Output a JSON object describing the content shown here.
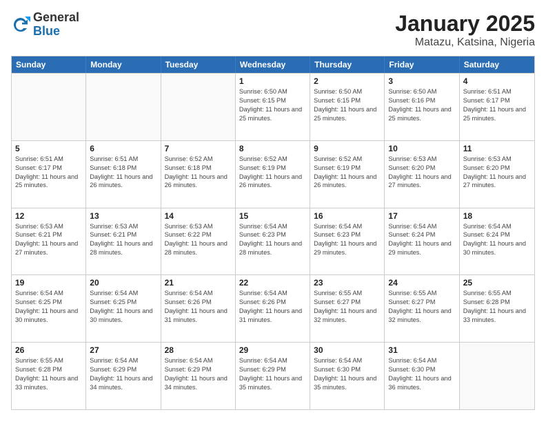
{
  "header": {
    "logo_general": "General",
    "logo_blue": "Blue",
    "title": "January 2025",
    "subtitle": "Matazu, Katsina, Nigeria"
  },
  "days_of_week": [
    "Sunday",
    "Monday",
    "Tuesday",
    "Wednesday",
    "Thursday",
    "Friday",
    "Saturday"
  ],
  "weeks": [
    [
      {
        "num": "",
        "info": ""
      },
      {
        "num": "",
        "info": ""
      },
      {
        "num": "",
        "info": ""
      },
      {
        "num": "1",
        "info": "Sunrise: 6:50 AM\nSunset: 6:15 PM\nDaylight: 11 hours and 25 minutes."
      },
      {
        "num": "2",
        "info": "Sunrise: 6:50 AM\nSunset: 6:15 PM\nDaylight: 11 hours and 25 minutes."
      },
      {
        "num": "3",
        "info": "Sunrise: 6:50 AM\nSunset: 6:16 PM\nDaylight: 11 hours and 25 minutes."
      },
      {
        "num": "4",
        "info": "Sunrise: 6:51 AM\nSunset: 6:17 PM\nDaylight: 11 hours and 25 minutes."
      }
    ],
    [
      {
        "num": "5",
        "info": "Sunrise: 6:51 AM\nSunset: 6:17 PM\nDaylight: 11 hours and 25 minutes."
      },
      {
        "num": "6",
        "info": "Sunrise: 6:51 AM\nSunset: 6:18 PM\nDaylight: 11 hours and 26 minutes."
      },
      {
        "num": "7",
        "info": "Sunrise: 6:52 AM\nSunset: 6:18 PM\nDaylight: 11 hours and 26 minutes."
      },
      {
        "num": "8",
        "info": "Sunrise: 6:52 AM\nSunset: 6:19 PM\nDaylight: 11 hours and 26 minutes."
      },
      {
        "num": "9",
        "info": "Sunrise: 6:52 AM\nSunset: 6:19 PM\nDaylight: 11 hours and 26 minutes."
      },
      {
        "num": "10",
        "info": "Sunrise: 6:53 AM\nSunset: 6:20 PM\nDaylight: 11 hours and 27 minutes."
      },
      {
        "num": "11",
        "info": "Sunrise: 6:53 AM\nSunset: 6:20 PM\nDaylight: 11 hours and 27 minutes."
      }
    ],
    [
      {
        "num": "12",
        "info": "Sunrise: 6:53 AM\nSunset: 6:21 PM\nDaylight: 11 hours and 27 minutes."
      },
      {
        "num": "13",
        "info": "Sunrise: 6:53 AM\nSunset: 6:21 PM\nDaylight: 11 hours and 28 minutes."
      },
      {
        "num": "14",
        "info": "Sunrise: 6:53 AM\nSunset: 6:22 PM\nDaylight: 11 hours and 28 minutes."
      },
      {
        "num": "15",
        "info": "Sunrise: 6:54 AM\nSunset: 6:23 PM\nDaylight: 11 hours and 28 minutes."
      },
      {
        "num": "16",
        "info": "Sunrise: 6:54 AM\nSunset: 6:23 PM\nDaylight: 11 hours and 29 minutes."
      },
      {
        "num": "17",
        "info": "Sunrise: 6:54 AM\nSunset: 6:24 PM\nDaylight: 11 hours and 29 minutes."
      },
      {
        "num": "18",
        "info": "Sunrise: 6:54 AM\nSunset: 6:24 PM\nDaylight: 11 hours and 30 minutes."
      }
    ],
    [
      {
        "num": "19",
        "info": "Sunrise: 6:54 AM\nSunset: 6:25 PM\nDaylight: 11 hours and 30 minutes."
      },
      {
        "num": "20",
        "info": "Sunrise: 6:54 AM\nSunset: 6:25 PM\nDaylight: 11 hours and 30 minutes."
      },
      {
        "num": "21",
        "info": "Sunrise: 6:54 AM\nSunset: 6:26 PM\nDaylight: 11 hours and 31 minutes."
      },
      {
        "num": "22",
        "info": "Sunrise: 6:54 AM\nSunset: 6:26 PM\nDaylight: 11 hours and 31 minutes."
      },
      {
        "num": "23",
        "info": "Sunrise: 6:55 AM\nSunset: 6:27 PM\nDaylight: 11 hours and 32 minutes."
      },
      {
        "num": "24",
        "info": "Sunrise: 6:55 AM\nSunset: 6:27 PM\nDaylight: 11 hours and 32 minutes."
      },
      {
        "num": "25",
        "info": "Sunrise: 6:55 AM\nSunset: 6:28 PM\nDaylight: 11 hours and 33 minutes."
      }
    ],
    [
      {
        "num": "26",
        "info": "Sunrise: 6:55 AM\nSunset: 6:28 PM\nDaylight: 11 hours and 33 minutes."
      },
      {
        "num": "27",
        "info": "Sunrise: 6:54 AM\nSunset: 6:29 PM\nDaylight: 11 hours and 34 minutes."
      },
      {
        "num": "28",
        "info": "Sunrise: 6:54 AM\nSunset: 6:29 PM\nDaylight: 11 hours and 34 minutes."
      },
      {
        "num": "29",
        "info": "Sunrise: 6:54 AM\nSunset: 6:29 PM\nDaylight: 11 hours and 35 minutes."
      },
      {
        "num": "30",
        "info": "Sunrise: 6:54 AM\nSunset: 6:30 PM\nDaylight: 11 hours and 35 minutes."
      },
      {
        "num": "31",
        "info": "Sunrise: 6:54 AM\nSunset: 6:30 PM\nDaylight: 11 hours and 36 minutes."
      },
      {
        "num": "",
        "info": ""
      }
    ]
  ]
}
